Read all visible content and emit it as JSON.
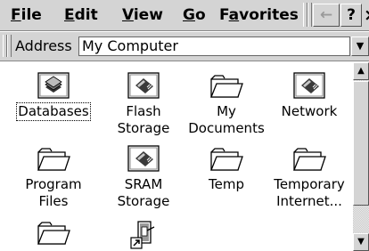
{
  "menubar": {
    "items": [
      {
        "accel": "F",
        "rest": "ile"
      },
      {
        "accel": "E",
        "rest": "dit"
      },
      {
        "accel": "V",
        "rest": "iew"
      },
      {
        "accel": "G",
        "rest": "o"
      },
      {
        "pre": "F",
        "accel": "a",
        "rest": "vorites"
      }
    ],
    "buttons": {
      "back": "←",
      "help": "?",
      "close": "×"
    }
  },
  "address": {
    "label": "Address",
    "value": "My Computer",
    "dropdown": "▼"
  },
  "items": [
    {
      "label": "Databases",
      "icon": "database-icon",
      "selected": true
    },
    {
      "label": "Flash",
      "label2": "Storage",
      "icon": "storage-card-icon"
    },
    {
      "label": "My",
      "label2": "Documents",
      "icon": "folder-icon"
    },
    {
      "label": "Network",
      "icon": "storage-card-icon"
    },
    {
      "label": "Program Files",
      "icon": "folder-icon"
    },
    {
      "label": "SRAM",
      "label2": "Storage",
      "icon": "storage-card-icon"
    },
    {
      "label": "Temp",
      "icon": "folder-icon"
    },
    {
      "label": "Temporary",
      "label2": "Internet...",
      "icon": "folder-icon"
    },
    {
      "label": "",
      "icon": "folder-icon"
    },
    {
      "label": "",
      "icon": "shortcut-icon"
    }
  ],
  "scrollbar": {
    "up": "▲",
    "down": "▼"
  }
}
